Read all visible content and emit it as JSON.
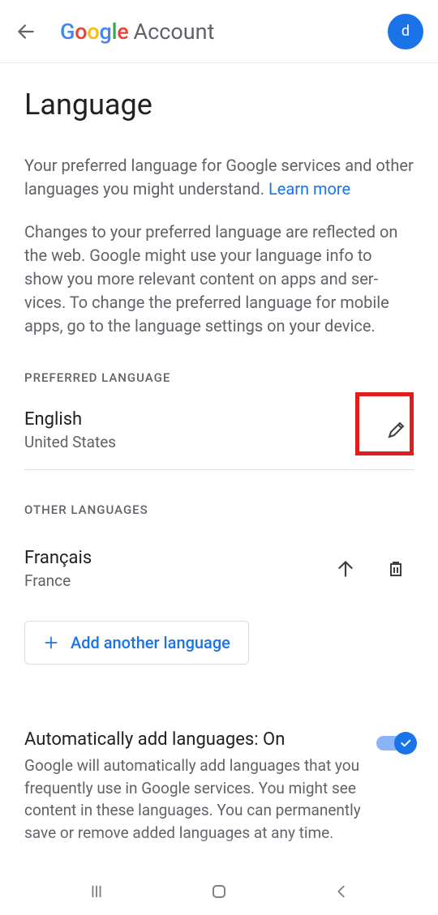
{
  "header": {
    "brand_g": "G",
    "brand_o1": "o",
    "brand_o2": "o",
    "brand_g2": "g",
    "brand_l": "l",
    "brand_e": "e",
    "account_label": "Account",
    "avatar_initial": "d"
  },
  "page": {
    "title": "Language",
    "desc1_part1": "Your preferred language for Google services and other languages you might understand. ",
    "learn_more": "Learn more",
    "desc2": "Changes to your preferred language are reflected on the web. Google might use your language info to show you more relevant content on apps and ser­vices. To change the preferred language for mobile apps, go to the language settings on your device."
  },
  "preferred": {
    "section_label": "PREFERRED LANGUAGE",
    "name": "English",
    "region": "United States"
  },
  "other": {
    "section_label": "OTHER LANGUAGES",
    "name": "Français",
    "region": "France",
    "add_label": "Add another language"
  },
  "auto": {
    "title": "Automatically add languages: On",
    "desc": "Google will automatically add languages that you frequently use in Google ser­vices. You might see content in these languages. You can permanently save or remove added languages at any time."
  }
}
